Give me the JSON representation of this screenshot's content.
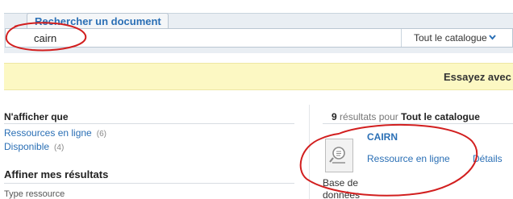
{
  "search": {
    "tab_label": "Rechercher un document",
    "query_value": "cairn",
    "scope_label": "Tout le catalogue"
  },
  "suggestion": {
    "text": "Essayez avec"
  },
  "facets": {
    "filter_heading": "N'afficher que",
    "filters": [
      {
        "label": "Ressources en ligne",
        "count": "(6)"
      },
      {
        "label": "Disponible",
        "count": "(4)"
      }
    ],
    "refine_heading": "Affiner mes résultats",
    "type_label": "Type ressource"
  },
  "results": {
    "count": "9",
    "count_suffix": "résultats pour",
    "scope": "Tout le catalogue",
    "items": [
      {
        "title": "CAIRN",
        "access_link": "Ressource en ligne",
        "details_link": "Détails",
        "type": "Base de données"
      }
    ]
  },
  "icons": {
    "scope_chevron": "chevron-down-icon",
    "document_thumbnail": "document-search-icon"
  },
  "colors": {
    "link": "#2a6fb5",
    "annotation": "#d21f1f",
    "suggestion_band": "#fcf8c3",
    "panel": "#e9eef3"
  }
}
